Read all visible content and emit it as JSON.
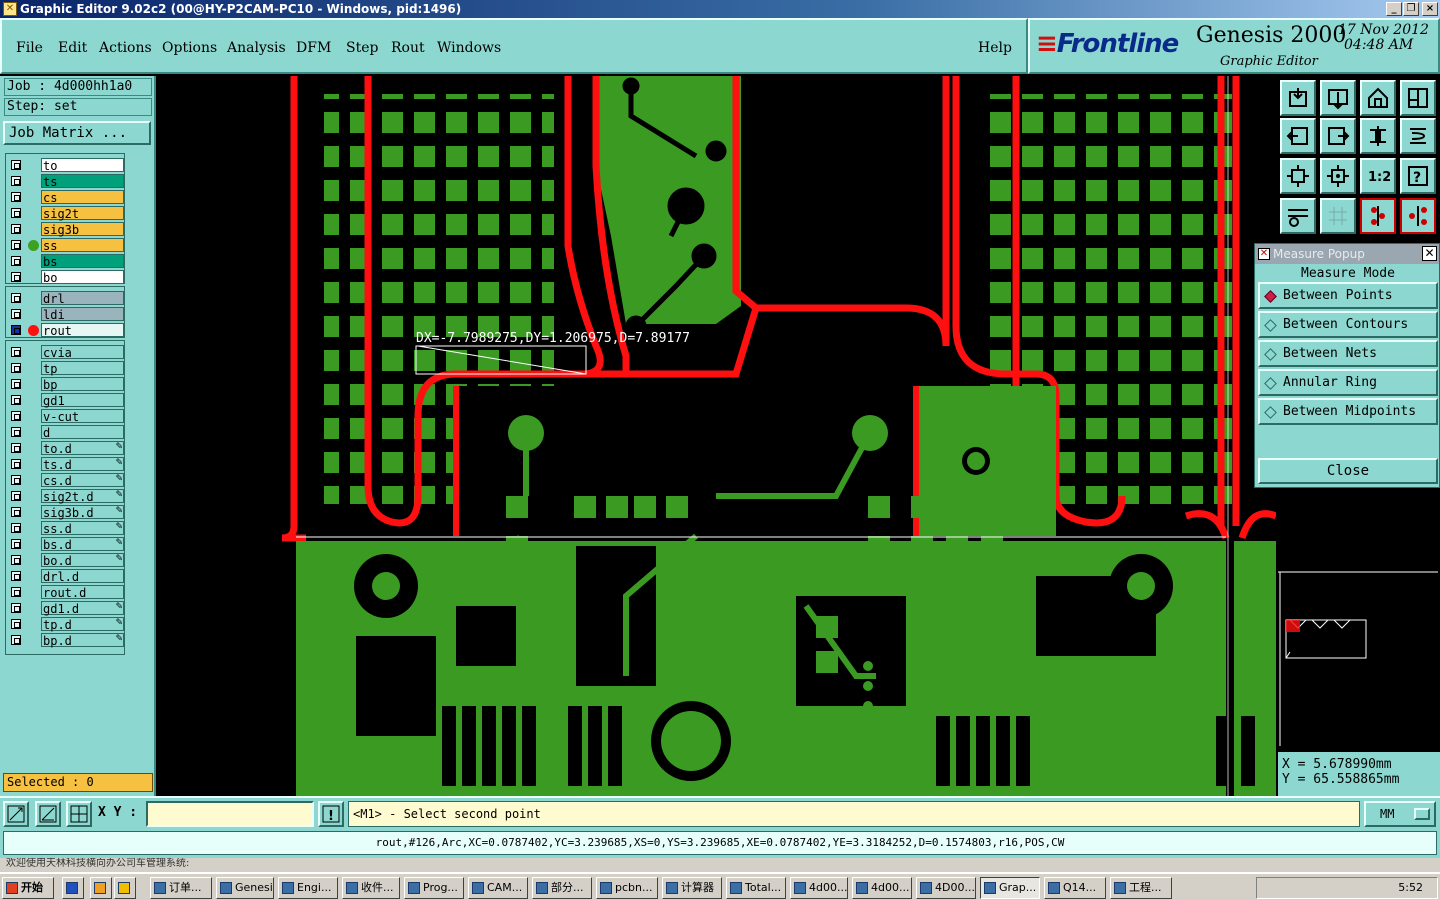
{
  "window": {
    "title": "Graphic Editor 9.02c2 (00@HY-P2CAM-PC10 - Windows, pid:1496)"
  },
  "menu": {
    "items": [
      "File",
      "Edit",
      "Actions",
      "Options",
      "Analysis",
      "DFM",
      "Step",
      "Rout",
      "Windows"
    ],
    "help": "Help"
  },
  "brand": {
    "logo": "Frontline",
    "product": "Genesis 2000",
    "subtitle": "Graphic Editor",
    "date": "17 Nov 2012",
    "time": "04:48 AM"
  },
  "job": {
    "job_label": "Job : 4d000hh1a0",
    "step_label": "Step: set",
    "matrix_button": "Job Matrix ..."
  },
  "layers": {
    "group1": [
      {
        "name": "to",
        "color": "#ffffff",
        "dot": ""
      },
      {
        "name": "ts",
        "color": "#00a07c",
        "dot": ""
      },
      {
        "name": "cs",
        "color": "#f6c040",
        "dot": ""
      },
      {
        "name": "sig2t",
        "color": "#f6c040",
        "dot": ""
      },
      {
        "name": "sig3b",
        "color": "#f6c040",
        "dot": ""
      },
      {
        "name": "ss",
        "color": "#f6c040",
        "dot": "#3ca020"
      },
      {
        "name": "bs",
        "color": "#00a07c",
        "dot": ""
      },
      {
        "name": "bo",
        "color": "#ffffff",
        "dot": ""
      }
    ],
    "group2": [
      {
        "name": "drl",
        "color": "#9ab4be",
        "dot": ""
      },
      {
        "name": "ldi",
        "color": "#9ab4be",
        "dot": ""
      },
      {
        "name": "rout",
        "color": "#e6f7f4",
        "dot": "#ff1010",
        "active": true
      }
    ],
    "group3": [
      {
        "name": "cvia",
        "pen": false
      },
      {
        "name": "tp",
        "pen": false
      },
      {
        "name": "bp",
        "pen": false
      },
      {
        "name": "gd1",
        "pen": false
      },
      {
        "name": "v-cut",
        "pen": false
      },
      {
        "name": "d",
        "pen": false
      },
      {
        "name": "to.d",
        "pen": true
      },
      {
        "name": "ts.d",
        "pen": true
      },
      {
        "name": "cs.d",
        "pen": true
      },
      {
        "name": "sig2t.d",
        "pen": true
      },
      {
        "name": "sig3b.d",
        "pen": true
      },
      {
        "name": "ss.d",
        "pen": true
      },
      {
        "name": "bs.d",
        "pen": true
      },
      {
        "name": "bo.d",
        "pen": true
      },
      {
        "name": "drl.d",
        "pen": false
      },
      {
        "name": "rout.d",
        "pen": false
      },
      {
        "name": "gd1.d",
        "pen": true
      },
      {
        "name": "tp.d",
        "pen": true
      },
      {
        "name": "bp.d",
        "pen": true
      }
    ]
  },
  "selected": "Selected : 0",
  "measurement_readout": "DX=-7.7989275,DY=1.206975,D=7.89177",
  "measure_popup": {
    "title": "Measure Popup",
    "mode_label": "Measure Mode",
    "options": [
      {
        "label": "Between Points",
        "selected": true
      },
      {
        "label": "Between Contours",
        "selected": false
      },
      {
        "label": "Between Nets",
        "selected": false
      },
      {
        "label": "Annular Ring",
        "selected": false
      },
      {
        "label": "Between Midpoints",
        "selected": false
      }
    ],
    "close_label": "Close"
  },
  "coords": {
    "x": "X = 5.678990mm",
    "y": "Y = 65.558865mm"
  },
  "status": {
    "xy_label": "X Y :",
    "message": "<M1> - Select second point",
    "units": "MM"
  },
  "info": "rout,#126,Arc,XC=0.0787402,YC=3.239685,XS=0,YS=3.239685,XE=0.0787402,YE=3.3184252,D=0.1574803,r16,POS,CW",
  "strip_text": "欢迎使用天林科技横向办公司车管理系统:",
  "taskbar": {
    "start": "开始",
    "items": [
      "订单...",
      "Genesis",
      "Engi...",
      "收件...",
      "Prog...",
      "CAM...",
      "部分...",
      "pcbn...",
      "计算器",
      "Total...",
      "4d00...",
      "4d00...",
      "4D00...",
      "Grap...",
      "Q14...",
      "工程..."
    ],
    "active_index": 13,
    "clock": "5:52"
  },
  "colors": {
    "accent": "#8cd8d0",
    "copper": "#3a9a22",
    "rout": "#ff1010",
    "highlight": "#f6c040"
  }
}
